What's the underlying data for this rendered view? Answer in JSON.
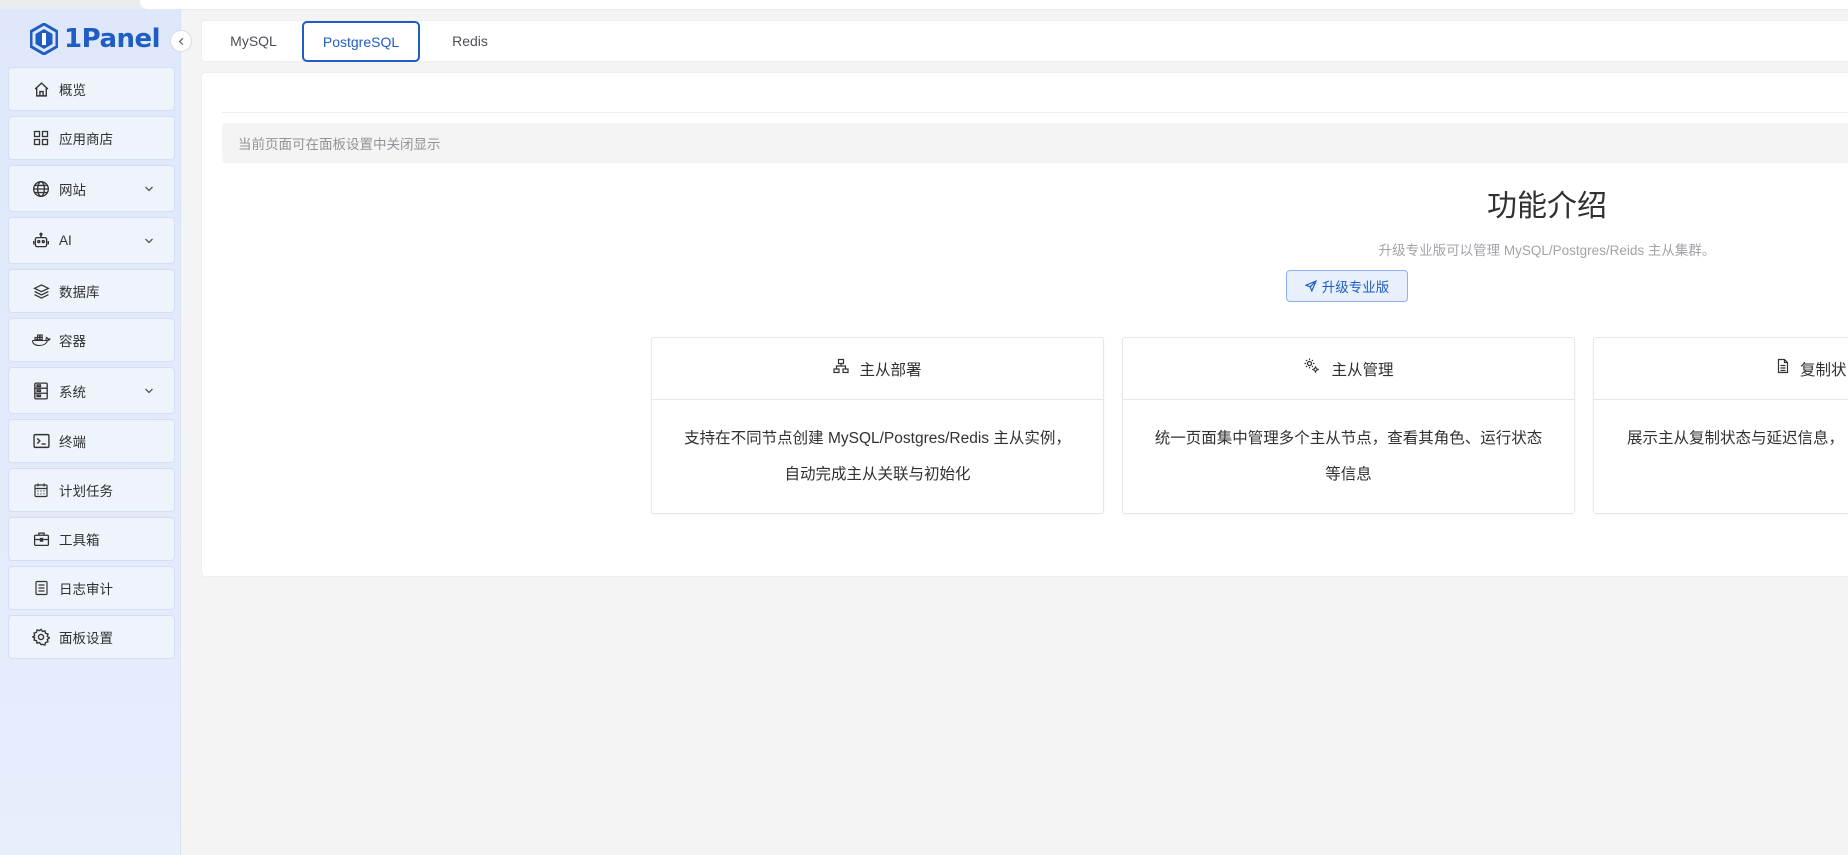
{
  "app": {
    "logo_text": "1Panel"
  },
  "sidebar": {
    "items": [
      {
        "label": "概览",
        "icon": "home-icon",
        "has_submenu": false
      },
      {
        "label": "应用商店",
        "icon": "grid-icon",
        "has_submenu": false
      },
      {
        "label": "网站",
        "icon": "globe-icon",
        "has_submenu": true
      },
      {
        "label": "AI",
        "icon": "robot-icon",
        "has_submenu": true
      },
      {
        "label": "数据库",
        "icon": "layers-icon",
        "has_submenu": false
      },
      {
        "label": "容器",
        "icon": "docker-icon",
        "has_submenu": false
      },
      {
        "label": "系统",
        "icon": "server-icon",
        "has_submenu": true
      },
      {
        "label": "终端",
        "icon": "terminal-icon",
        "has_submenu": false
      },
      {
        "label": "计划任务",
        "icon": "calendar-icon",
        "has_submenu": false
      },
      {
        "label": "工具箱",
        "icon": "toolbox-icon",
        "has_submenu": false
      },
      {
        "label": "日志审计",
        "icon": "log-icon",
        "has_submenu": false
      },
      {
        "label": "面板设置",
        "icon": "gear-icon",
        "has_submenu": false
      }
    ]
  },
  "tabs": [
    {
      "label": "MySQL",
      "active": false
    },
    {
      "label": "PostgreSQL",
      "active": true
    },
    {
      "label": "Redis",
      "active": false
    }
  ],
  "main": {
    "notice": "当前页面可在面板设置中关闭显示",
    "title": "功能介绍",
    "subtitle": "升级专业版可以管理 MySQL/Postgres/Reids 主从集群。",
    "upgrade_button": "升级专业版",
    "features": [
      {
        "title": "主从部署",
        "icon": "sitemap-icon",
        "line1": "支持在不同节点创建 MySQL/Postgres/Redis 主从实例，",
        "line2": "自动完成主从关联与初始化"
      },
      {
        "title": "主从管理",
        "icon": "gears-icon",
        "line1": "统一页面集中管理多个主从节点，查看其角色、运行状态",
        "line2": "等信息"
      },
      {
        "title": "复制状",
        "icon": "document-icon",
        "line1": "展示主从复制状态与延迟信息，",
        "line2": ""
      }
    ]
  },
  "colors": {
    "accent": "#1f5dc2",
    "sidebar_bg": "#e3ebfb",
    "page_bg": "#f4f4f4"
  }
}
